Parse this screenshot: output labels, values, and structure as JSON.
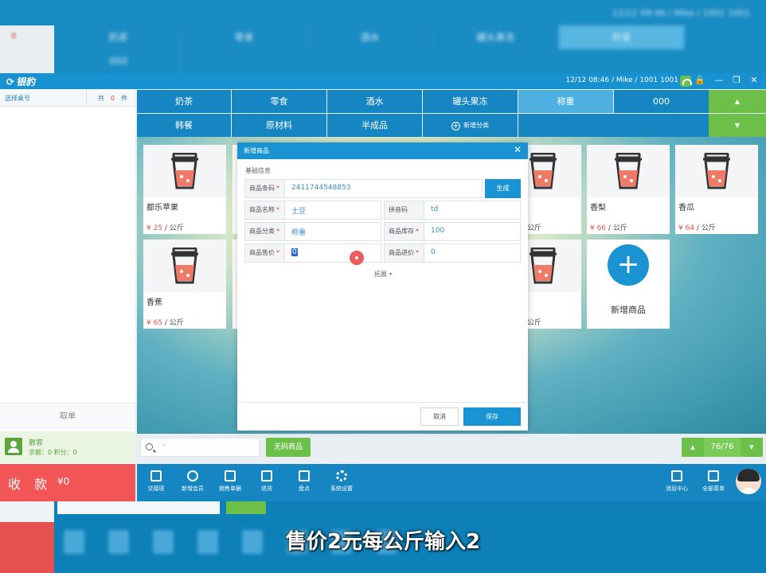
{
  "titlebar": {
    "app_name": "银豹",
    "status": "12/12 08:46 / Mike / 1001 1001",
    "wifi_icon": "wifi-icon",
    "lock_icon": "lock-icon",
    "minimize": "—",
    "restore": "❐",
    "close": "✕"
  },
  "left_panel": {
    "table_label": "选择桌号",
    "count_prefix": "共",
    "count_value": "0",
    "count_unit": "件",
    "cancel_order": "取单",
    "member_name": "散客",
    "member_info": "余额：0  积分：0",
    "pay_label": "收 款",
    "pay_amount": "¥0"
  },
  "categories": [
    {
      "label": "奶茶",
      "selected": false
    },
    {
      "label": "零食",
      "selected": false
    },
    {
      "label": "酒水",
      "selected": false
    },
    {
      "label": "罐头果冻",
      "selected": false
    },
    {
      "label": "称重",
      "selected": true
    },
    {
      "label": "000",
      "selected": false
    },
    {
      "label": "韩餐",
      "selected": false
    },
    {
      "label": "原材料",
      "selected": false
    },
    {
      "label": "半成品",
      "selected": false
    },
    {
      "label": "新增分类",
      "selected": false
    }
  ],
  "category_nav": {
    "up": "▲",
    "down": "▼"
  },
  "products": [
    {
      "name": "都乐苹果",
      "price": "¥ 25",
      "unit": "/ 公斤"
    },
    {
      "name": "",
      "price": "",
      "unit": "公斤"
    },
    {
      "name": "香梨",
      "price": "¥ 66",
      "unit": "/ 公斤"
    },
    {
      "name": "香瓜",
      "price": "¥ 64",
      "unit": "/ 公斤"
    },
    {
      "name": "香蕉",
      "price": "¥ 65",
      "unit": "/ 公斤"
    },
    {
      "name": "",
      "price": "",
      "unit": "公斤"
    }
  ],
  "add_product": {
    "label": "新增商品",
    "icon": "plus-icon"
  },
  "search": {
    "value": "·",
    "no_barcode": "无码商品",
    "page": "76/76",
    "page_up": "▲",
    "page_down": "▼"
  },
  "toolbar": [
    {
      "label": "交接班",
      "icon": "handover-icon"
    },
    {
      "label": "新增会员",
      "icon": "add-member-icon"
    },
    {
      "label": "销售单据",
      "icon": "sales-doc-icon"
    },
    {
      "label": "退货",
      "icon": "return-icon"
    },
    {
      "label": "盘点",
      "icon": "inventory-icon"
    },
    {
      "label": "系统设置",
      "icon": "settings-icon"
    },
    {
      "label": "消息中心",
      "icon": "message-icon"
    },
    {
      "label": "全部菜单",
      "icon": "menu-icon"
    }
  ],
  "dialog": {
    "title": "新增商品",
    "close": "✕",
    "section": "基础信息",
    "fields": {
      "barcode": {
        "label": "商品条码",
        "value": "2411744548853"
      },
      "name": {
        "label": "商品名称",
        "value": "土豆"
      },
      "pinyin": {
        "label": "拼音码",
        "value": "td"
      },
      "category": {
        "label": "商品分类",
        "value": "称重"
      },
      "stock": {
        "label": "商品库存",
        "value": "100"
      },
      "sale_price": {
        "label": "商品售价",
        "value": "0"
      },
      "cost_price": {
        "label": "商品进价",
        "value": "0"
      }
    },
    "generate": "生成",
    "expand": "拓展",
    "expand_arrow": "▾",
    "cancel": "取消",
    "save": "保存"
  },
  "background": {
    "tabs": [
      "奶茶",
      "零食",
      "酒水",
      "罐头果冻",
      "称重",
      "000"
    ],
    "status": "12/12 09:46 / Mike / 1001 1001"
  },
  "subtitle": "售价2元每公斤输入2",
  "colors": {
    "accent": "#1a93d2",
    "green": "#6cc04a",
    "pay_red": "#f25555",
    "price_red": "#e45050"
  }
}
